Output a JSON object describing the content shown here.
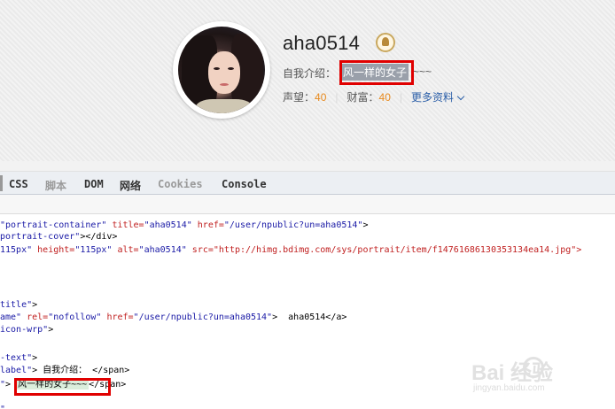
{
  "profile": {
    "username": "aha0514",
    "intro_label": "自我介绍：",
    "intro_text": "风一样的女子",
    "intro_suffix": "~~~",
    "stats": {
      "reputation_label": "声望：",
      "reputation_value": "40",
      "wealth_label": "财富：",
      "wealth_value": "40",
      "more_label": "更多资料"
    },
    "badge_icon": "pen-nib-badge-icon"
  },
  "devtools": {
    "tabs": [
      {
        "label": "CSS",
        "enabled": true
      },
      {
        "label": "脚本",
        "enabled": false
      },
      {
        "label": "DOM",
        "enabled": true
      },
      {
        "label": "网络",
        "enabled": true
      },
      {
        "label": "Cookies",
        "enabled": false
      },
      {
        "label": "Console",
        "enabled": true
      }
    ],
    "code_lines": [
      {
        "a": "\"portrait-container\" ",
        "b": "title=",
        "c": "\"aha0514\" ",
        "d": "href=",
        "e": "\"/user/npublic?un=aha0514\"",
        "f": ">"
      },
      {
        "a": "portrait-cover\"",
        "b": "></div>",
        "c": "",
        "d": "",
        "e": "",
        "f": ""
      },
      {
        "a": "115px\" ",
        "b": "height=",
        "c": "\"115px\" ",
        "d": "alt=",
        "e": "\"aha0514\" ",
        "f": "src=\"http://himg.bdimg.com/sys/portrait/item/f14761686130353134ea14.jpg\">"
      },
      {
        "a": "",
        "b": "",
        "c": "",
        "d": "",
        "e": "",
        "f": ""
      },
      {
        "a": "",
        "b": "",
        "c": "",
        "d": "",
        "e": "",
        "f": ""
      },
      {
        "a": "title\"",
        "b": ">",
        "c": "",
        "d": "",
        "e": "",
        "f": ""
      },
      {
        "a": "ame\" ",
        "b": "rel=",
        "c": "\"nofollow\" ",
        "d": "href=",
        "e": "\"/user/npublic?un=aha0514\"",
        "f": ">  aha0514</a>"
      },
      {
        "a": "icon-wrp\"",
        "b": ">",
        "c": "",
        "d": "",
        "e": "",
        "f": ""
      },
      {
        "a": "",
        "b": "",
        "c": "",
        "d": "",
        "e": "",
        "f": ""
      },
      {
        "a": "-text\"",
        "b": ">",
        "c": "",
        "d": "",
        "e": "",
        "f": ""
      },
      {
        "a": "label\"",
        "b": "> 自我介绍： </span>",
        "c": "",
        "d": "",
        "e": "",
        "f": ""
      },
      {
        "a": "\"",
        "b": "> ",
        "c": "风一样的女子~~~",
        "d": "</span>",
        "e": "",
        "f": ""
      },
      {
        "a": "",
        "b": "",
        "c": "",
        "d": "",
        "e": "",
        "f": ""
      },
      {
        "a": "\"",
        "b": "",
        "c": "",
        "d": "",
        "e": "",
        "f": ""
      }
    ]
  },
  "watermark": {
    "text": "Bai 经验",
    "sub": "jingyan.baidu.com"
  }
}
